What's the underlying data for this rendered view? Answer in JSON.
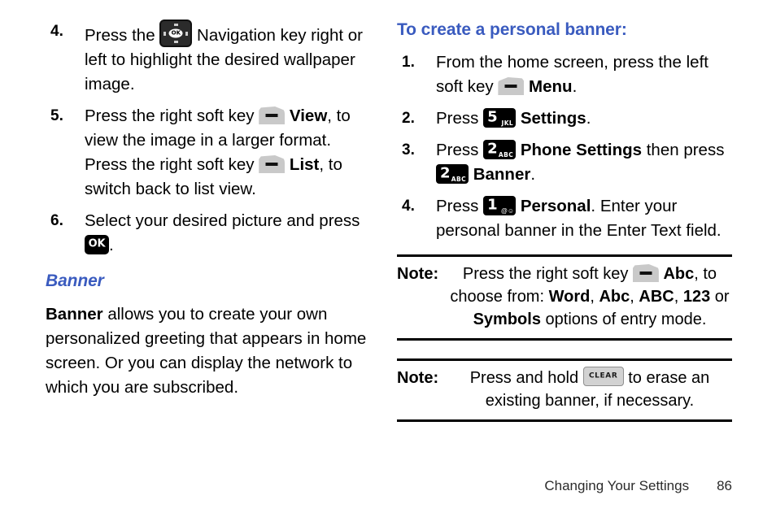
{
  "left_column": {
    "steps": [
      {
        "number": "4.",
        "icon": "navigation-key-icon",
        "text_before": "Press the",
        "text_after": "Navigation key right or left to highlight the desired wallpaper image."
      },
      {
        "number": "5.",
        "text_a": "Press the right soft key",
        "icon_a": "right-soft-key-icon",
        "bold_a": "View",
        "text_b": ", to view the image in a larger format. Press the right soft key",
        "icon_b": "right-soft-key-icon",
        "bold_b": "List",
        "text_c": ", to switch back to list view."
      },
      {
        "number": "6.",
        "text_before": "Select your desired picture and press",
        "icon": "ok-key-icon",
        "text_after": "."
      }
    ],
    "section_heading": "Banner",
    "paragraph_bold_lead": "Banner",
    "paragraph": " allows you to create your own personalized greeting that appears in home screen. Or you can display the network to which you are subscribed."
  },
  "right_column": {
    "heading": "To create a personal banner:",
    "steps": [
      {
        "number": "1.",
        "text_before": "From the home screen, press the left soft key",
        "icon": "left-soft-key-icon",
        "bold": "Menu",
        "text_after": "."
      },
      {
        "number": "2.",
        "text_before": "Press",
        "icon": "key-5-jkl-icon",
        "key_digit": "5",
        "key_sub": "JKL",
        "bold": "Settings",
        "text_after": "."
      },
      {
        "number": "3.",
        "text_before": "Press",
        "icon_a": "key-2-abc-icon",
        "key_digit": "2",
        "key_sub": "ABC",
        "bold_a": "Phone Settings",
        "text_mid": "then press",
        "bold_b": "Banner",
        "text_after": "."
      },
      {
        "number": "4.",
        "text_before": "Press",
        "icon": "key-1-icon",
        "key_digit": "1",
        "bold": "Personal",
        "text_after": ". Enter your personal banner in the Enter Text field."
      }
    ],
    "notes": [
      {
        "label": "Note:",
        "text_a": "Press the right soft key",
        "icon": "right-soft-key-icon",
        "bold_a": "Abc",
        "text_b": ", to choose from: ",
        "opt1": "Word",
        "opt2": "Abc",
        "opt3": "ABC",
        "opt4": "123",
        "text_c": " or ",
        "opt5": "Symbols",
        "text_d": " options of entry mode."
      },
      {
        "label": "Note:",
        "text_before": "Press and hold",
        "icon": "clear-key-icon",
        "text_after": "to erase an existing banner, if necessary."
      }
    ]
  },
  "footer": {
    "title": "Changing Your Settings",
    "page_number": "86"
  },
  "colors": {
    "heading_blue": "#3a5bbf",
    "text_black": "#000000",
    "key_black": "#000000",
    "soft_key_grey": "#c9c9c9",
    "clear_key_grey": "#d2d2d2"
  }
}
